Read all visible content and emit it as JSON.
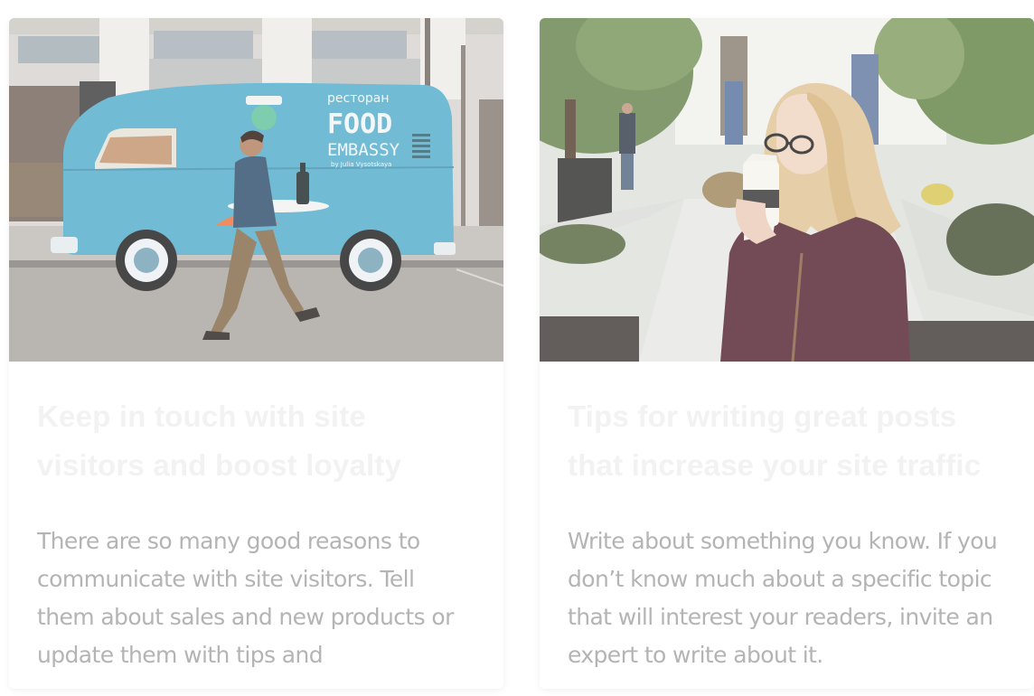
{
  "cards": [
    {
      "title": "Keep in touch with site visitors and boost loyalty",
      "excerpt": "There are so many good reasons to communicate with site visitors. Tell them about sales and new products or update them with tips and",
      "image": {
        "subject": "man walking past blue food truck",
        "van_text_small": "ресторан",
        "van_text_large_1": "FOOD",
        "van_text_large_2": "EMBASSY",
        "van_text_credit": "by Julia Vysotskaya",
        "colors": {
          "van": "#5fb2cf",
          "building": "#dad7d3",
          "street": "#a8a6a2"
        }
      }
    },
    {
      "title": "Tips for writing great posts that increase your site traffic",
      "excerpt": "Write about something you know. If you don’t know much about a specific topic that will interest your readers, invite an expert to write about it.",
      "image": {
        "subject": "woman drinking coffee in a park",
        "colors": {
          "foliage": "#6f8a58",
          "path": "#dfe0dd",
          "sweater": "#5c2e3c",
          "hair": "#e2c89a"
        }
      }
    }
  ]
}
